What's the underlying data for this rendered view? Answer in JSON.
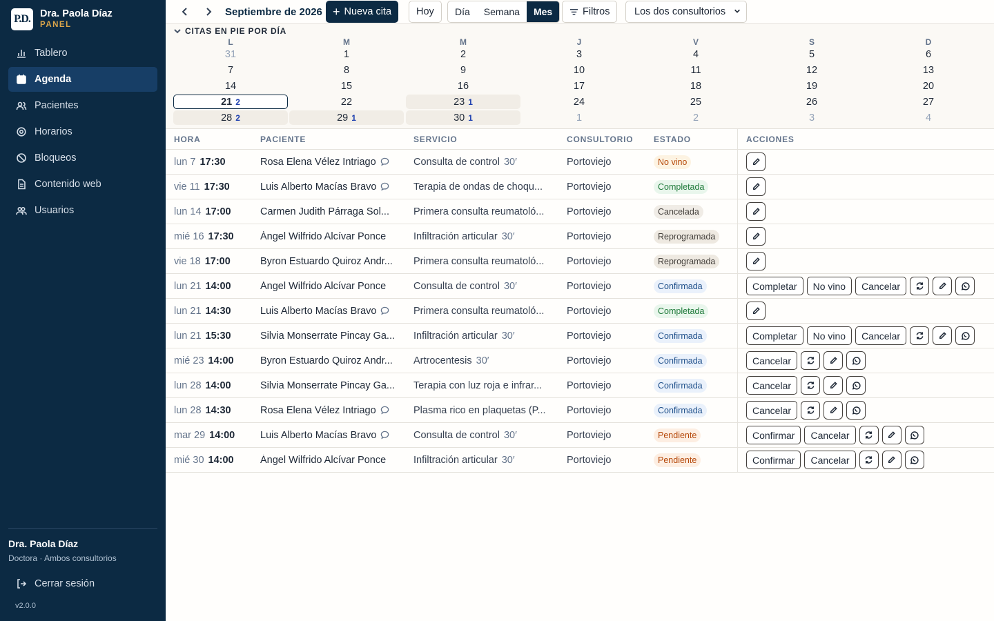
{
  "sidebar": {
    "logo_text": "P.D.",
    "brand_name": "Dra. Paola Díaz",
    "brand_sub": "PANEL",
    "items": [
      {
        "label": "Tablero",
        "icon": "bar-chart-icon",
        "active": false
      },
      {
        "label": "Agenda",
        "icon": "calendar-icon",
        "active": true
      },
      {
        "label": "Pacientes",
        "icon": "users-icon",
        "active": false
      },
      {
        "label": "Horarios",
        "icon": "gear-icon",
        "active": false
      },
      {
        "label": "Bloqueos",
        "icon": "block-icon",
        "active": false
      },
      {
        "label": "Contenido web",
        "icon": "document-icon",
        "active": false
      },
      {
        "label": "Usuarios",
        "icon": "user-group-icon",
        "active": false
      }
    ],
    "user_name": "Dra. Paola Díaz",
    "user_role": "Doctora · Ambos consultorios",
    "logout_label": "Cerrar sesión",
    "version": "v2.0.0"
  },
  "toolbar": {
    "month_label": "Septiembre de 2026",
    "new_label": "Nueva cita",
    "today_label": "Hoy",
    "views": [
      "Día",
      "Semana",
      "Mes"
    ],
    "active_view": "Mes",
    "filters_label": "Filtros",
    "location_value": "Los dos consultorios"
  },
  "calendar": {
    "title": "CITAS EN PIE POR DÍA",
    "weekdays": [
      "L",
      "M",
      "M",
      "J",
      "V",
      "S",
      "D"
    ],
    "weeks": [
      [
        {
          "d": "31",
          "m": true
        },
        {
          "d": "1"
        },
        {
          "d": "2"
        },
        {
          "d": "3"
        },
        {
          "d": "4"
        },
        {
          "d": "5"
        },
        {
          "d": "6"
        }
      ],
      [
        {
          "d": "7"
        },
        {
          "d": "8"
        },
        {
          "d": "9"
        },
        {
          "d": "10"
        },
        {
          "d": "11"
        },
        {
          "d": "12"
        },
        {
          "d": "13"
        }
      ],
      [
        {
          "d": "14"
        },
        {
          "d": "15"
        },
        {
          "d": "16"
        },
        {
          "d": "17"
        },
        {
          "d": "18"
        },
        {
          "d": "19"
        },
        {
          "d": "20"
        }
      ],
      [
        {
          "d": "21",
          "c": "2",
          "sel": true
        },
        {
          "d": "22"
        },
        {
          "d": "23",
          "c": "1"
        },
        {
          "d": "24"
        },
        {
          "d": "25"
        },
        {
          "d": "26"
        },
        {
          "d": "27"
        }
      ],
      [
        {
          "d": "28",
          "c": "2"
        },
        {
          "d": "29",
          "c": "1"
        },
        {
          "d": "30",
          "c": "1"
        },
        {
          "d": "1",
          "m": true
        },
        {
          "d": "2",
          "m": true
        },
        {
          "d": "3",
          "m": true
        },
        {
          "d": "4",
          "m": true
        }
      ]
    ]
  },
  "table": {
    "headers": {
      "hora": "HORA",
      "paciente": "PACIENTE",
      "servicio": "SERVICIO",
      "consultorio": "CONSULTORIO",
      "estado": "ESTADO",
      "acciones": "ACCIONES"
    },
    "rows": [
      {
        "day": "lun 7",
        "time": "17:30",
        "patient": "Rosa Elena Vélez Intriago",
        "note": true,
        "service": "Consulta de control",
        "dur": "30′",
        "office": "Portoviejo",
        "status": "No vino",
        "st": "novino",
        "actions": [
          "edit"
        ]
      },
      {
        "day": "vie 11",
        "time": "17:30",
        "patient": "Luis Alberto Macías Bravo",
        "note": true,
        "service": "Terapia de ondas de choqu...",
        "dur": "",
        "office": "Portoviejo",
        "status": "Completada",
        "st": "comp",
        "actions": [
          "edit"
        ]
      },
      {
        "day": "lun 14",
        "time": "17:00",
        "patient": "Carmen Judith Párraga Sol...",
        "note": false,
        "service": "Primera consulta reumatoló...",
        "dur": "",
        "office": "Portoviejo",
        "status": "Cancelada",
        "st": "canc",
        "actions": [
          "edit"
        ]
      },
      {
        "day": "mié 16",
        "time": "17:30",
        "patient": "Ángel Wilfrido Alcívar Ponce",
        "note": false,
        "service": "Infiltración articular",
        "dur": "30′",
        "office": "Portoviejo",
        "status": "Reprogramada",
        "st": "repro",
        "actions": [
          "edit"
        ]
      },
      {
        "day": "vie 18",
        "time": "17:00",
        "patient": "Byron Estuardo Quiroz Andr...",
        "note": false,
        "service": "Primera consulta reumatoló...",
        "dur": "",
        "office": "Portoviejo",
        "status": "Reprogramada",
        "st": "repro",
        "actions": [
          "edit"
        ]
      },
      {
        "day": "lun 21",
        "time": "14:00",
        "patient": "Ángel Wilfrido Alcívar Ponce",
        "note": false,
        "service": "Consulta de control",
        "dur": "30′",
        "office": "Portoviejo",
        "status": "Confirmada",
        "st": "conf",
        "actions": [
          "Completar",
          "No vino",
          "Cancelar",
          "resched",
          "edit",
          "whatsapp"
        ]
      },
      {
        "day": "lun 21",
        "time": "14:30",
        "patient": "Luis Alberto Macías Bravo",
        "note": true,
        "service": "Primera consulta reumatoló...",
        "dur": "",
        "office": "Portoviejo",
        "status": "Completada",
        "st": "comp",
        "actions": [
          "edit"
        ]
      },
      {
        "day": "lun 21",
        "time": "15:30",
        "patient": "Silvia Monserrate Pincay Ga...",
        "note": false,
        "service": "Infiltración articular",
        "dur": "30′",
        "office": "Portoviejo",
        "status": "Confirmada",
        "st": "conf",
        "actions": [
          "Completar",
          "No vino",
          "Cancelar",
          "resched",
          "edit",
          "whatsapp"
        ]
      },
      {
        "day": "mié 23",
        "time": "14:00",
        "patient": "Byron Estuardo Quiroz Andr...",
        "note": false,
        "service": "Artrocentesis",
        "dur": "30′",
        "office": "Portoviejo",
        "status": "Confirmada",
        "st": "conf",
        "actions": [
          "Cancelar",
          "resched",
          "edit",
          "whatsapp"
        ]
      },
      {
        "day": "lun 28",
        "time": "14:00",
        "patient": "Silvia Monserrate Pincay Ga...",
        "note": false,
        "service": "Terapia con luz roja e infrar...",
        "dur": "",
        "office": "Portoviejo",
        "status": "Confirmada",
        "st": "conf",
        "actions": [
          "Cancelar",
          "resched",
          "edit",
          "whatsapp"
        ]
      },
      {
        "day": "lun 28",
        "time": "14:30",
        "patient": "Rosa Elena Vélez Intriago",
        "note": true,
        "service": "Plasma rico en plaquetas (P...",
        "dur": "",
        "office": "Portoviejo",
        "status": "Confirmada",
        "st": "conf",
        "actions": [
          "Cancelar",
          "resched",
          "edit",
          "whatsapp"
        ]
      },
      {
        "day": "mar 29",
        "time": "14:00",
        "patient": "Luis Alberto Macías Bravo",
        "note": true,
        "service": "Consulta de control",
        "dur": "30′",
        "office": "Portoviejo",
        "status": "Pendiente",
        "st": "pend",
        "actions": [
          "Confirmar",
          "Cancelar",
          "resched",
          "edit",
          "whatsapp"
        ]
      },
      {
        "day": "mié 30",
        "time": "14:00",
        "patient": "Ángel Wilfrido Alcívar Ponce",
        "note": false,
        "service": "Infiltración articular",
        "dur": "30′",
        "office": "Portoviejo",
        "status": "Pendiente",
        "st": "pend",
        "actions": [
          "Confirmar",
          "Cancelar",
          "resched",
          "edit",
          "whatsapp"
        ]
      }
    ]
  }
}
